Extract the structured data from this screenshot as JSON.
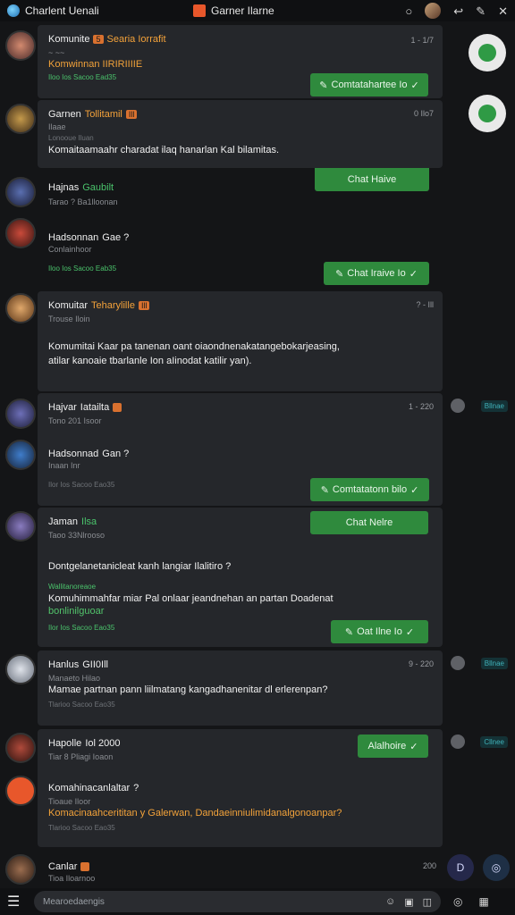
{
  "topbar": {
    "left_title": "Charlent Uenali",
    "center_title": "Garner Ilarne",
    "icons": [
      "globe-icon",
      "app-icon",
      "chat-icon",
      "avatar",
      "reply-icon",
      "settings-icon",
      "close-icon"
    ]
  },
  "colors": {
    "background": "#141517",
    "card": "#25272b",
    "accent_green": "#2f8a3d",
    "accent_orange": "#f4a23a",
    "teal": "#3fb0b8"
  },
  "messages": [
    {
      "sender": "Komunite",
      "badge": "5",
      "tag": "Searia Iorrafit",
      "sub": "~ ~~",
      "text": "Komwinnan IIRIRIIIIE",
      "meta": "Iloo Ios Sacoo Ead35",
      "time": "1 - 1/7",
      "button": "Comtatahartee Io"
    },
    {
      "sender": "Garnen",
      "tag": "Tollitamil",
      "badge": "Ill",
      "sub": "Ilaae",
      "meta_top": "Lonooue Iluan",
      "text": "Komaitaamaahr charadat ilaq hanarlan Kal bilamitas.",
      "time": "0 Ilo7"
    },
    {
      "sender": "Hajnas",
      "tag": "Gaubilt",
      "sub": "Tarao ? Ba1lloonan",
      "button": "Chat Haive"
    },
    {
      "sender": "Hadsonnan",
      "tag": "Gae ?",
      "sub": "Conlainhoor",
      "meta": "Iloo Ios Sacoo Eab35",
      "button": "Chat Iraive Io"
    },
    {
      "sender": "Komuitar",
      "tag": "Teharylille",
      "badge": "Ill",
      "sub": "Trouse Iloin",
      "text": "Komumitai Kaar pa tanenan oant oiaondnenakatangebokarjeasing,",
      "text2": "atilar kanoaie tbarlanle Ion aIinodat katilir yan).",
      "time": "? - Ill"
    },
    {
      "sender": "Hajvar",
      "tag": "Iatailta",
      "badge": "",
      "sub": "Tono 201 Isoor",
      "time": "1 - 220",
      "side_label": "Bllnae"
    },
    {
      "sender": "Hadsonnad",
      "tag": "Gan ?",
      "sub": "Inaan Inr",
      "meta": "Ilor Ios Sacoo Eao35",
      "button": "Comtatatonn bilo"
    },
    {
      "sender": "Jaman",
      "tag": "Ilsa",
      "sub": "Taoo 33Nlrooso",
      "button": "Chat Nelre",
      "text": "Dontgelanetanicleat kanh langiar Ilalitiro ?",
      "meta_top": "Wallitanoreaoe",
      "text2": "Komuhimmahfar miar Pal onlaar jeandnehan an partan Doadenat",
      "text3": "bonlinilguoar",
      "meta": "Ilor Ios Sacoo Eao35",
      "button2": "Oat Ilne Io"
    },
    {
      "sender": "Hanlus",
      "tag": "GII0Ill",
      "sub": "Manaeto Hilao",
      "text": "Mamae partnan pann liilmatang kangadhanenitar dl erlerenpan?",
      "meta": "Tlarioo Sacoo Eao35",
      "time": "9 - 220",
      "side_label": "Bllnae"
    },
    {
      "sender": "Hapolle",
      "tag": "Iol 2000",
      "sub": "Tiar 8 Pliagi Ioaon",
      "button": "Alalhoire",
      "side_label": "Cllnee"
    },
    {
      "sender": "Komahinacanlaltar",
      "tag": "?",
      "sub": "Tioaue Iloor",
      "text": "Komacinaahcerititan y Galerwan, Dandaeinniulimidanalgonoanpar?",
      "meta": "Tlarioo Sacoo Eao35"
    },
    {
      "sender": "Canlar",
      "tag": "",
      "sub": "Tioa Iloarnoo",
      "time": "200"
    }
  ],
  "bottombar": {
    "placeholder": "Mearoedaengis",
    "icons": [
      "menu-icon",
      "emoji-icon",
      "camera-icon",
      "attach-icon",
      "send-icon",
      "gallery-icon"
    ]
  }
}
